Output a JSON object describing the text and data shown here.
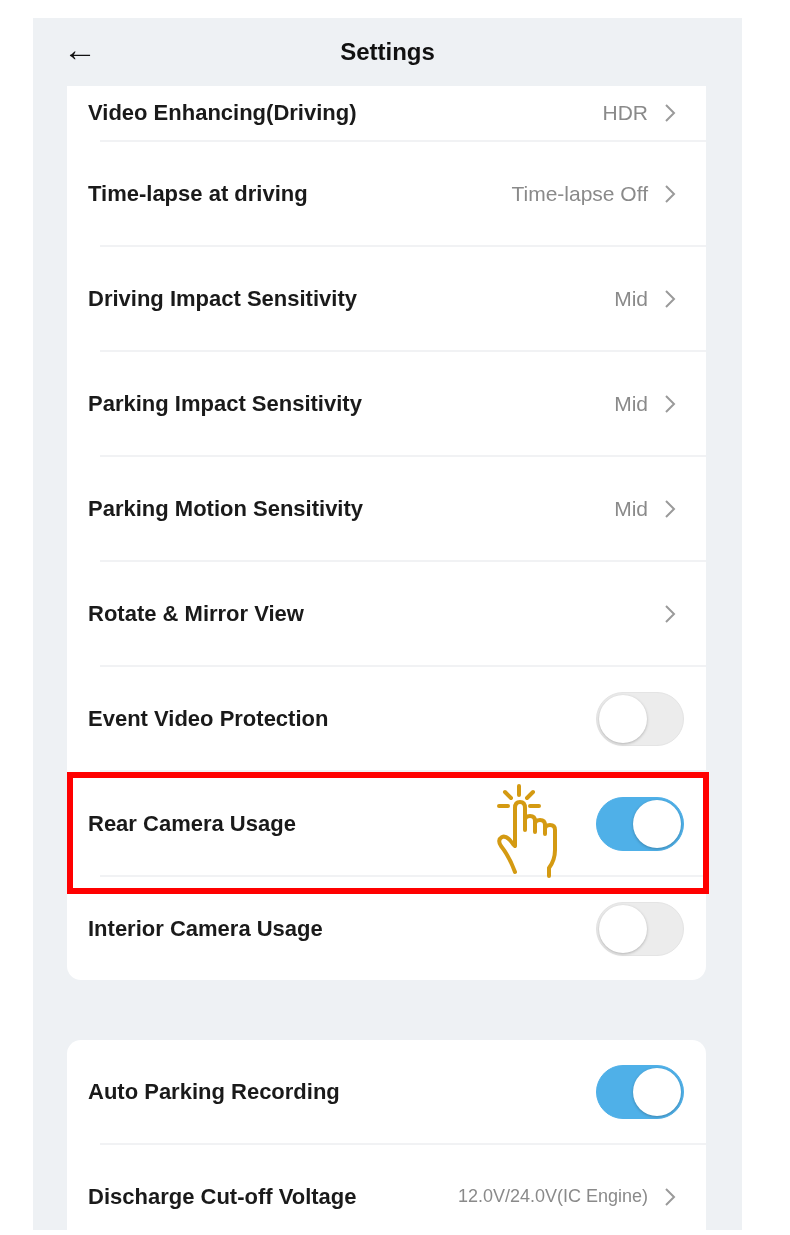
{
  "header": {
    "back_icon": "←",
    "title": "Settings"
  },
  "groups": [
    {
      "rows": [
        {
          "kind": "value",
          "label": "Video Enhancing(Driving)",
          "value": "HDR",
          "highlighted": false,
          "partial": true
        },
        {
          "kind": "value",
          "label": "Time-lapse at driving",
          "value": "Time-lapse Off",
          "highlighted": false
        },
        {
          "kind": "value",
          "label": "Driving Impact Sensitivity",
          "value": "Mid",
          "highlighted": false
        },
        {
          "kind": "value",
          "label": "Parking Impact Sensitivity",
          "value": "Mid",
          "highlighted": false
        },
        {
          "kind": "value",
          "label": "Parking Motion Sensitivity",
          "value": "Mid",
          "highlighted": false
        },
        {
          "kind": "link",
          "label": "Rotate & Mirror View",
          "highlighted": false
        },
        {
          "kind": "toggle",
          "label": "Event Video Protection",
          "on": false,
          "highlighted": false
        },
        {
          "kind": "toggle",
          "label": "Rear Camera Usage",
          "on": true,
          "highlighted": true
        },
        {
          "kind": "toggle",
          "label": "Interior Camera Usage",
          "on": false,
          "highlighted": false
        }
      ]
    },
    {
      "rows": [
        {
          "kind": "toggle",
          "label": "Auto Parking Recording",
          "on": true,
          "highlighted": false
        },
        {
          "kind": "value",
          "label": "Discharge Cut-off Voltage",
          "value": "12.0V/24.0V(IC Engine)",
          "highlighted": false,
          "small_value": true
        }
      ]
    }
  ]
}
